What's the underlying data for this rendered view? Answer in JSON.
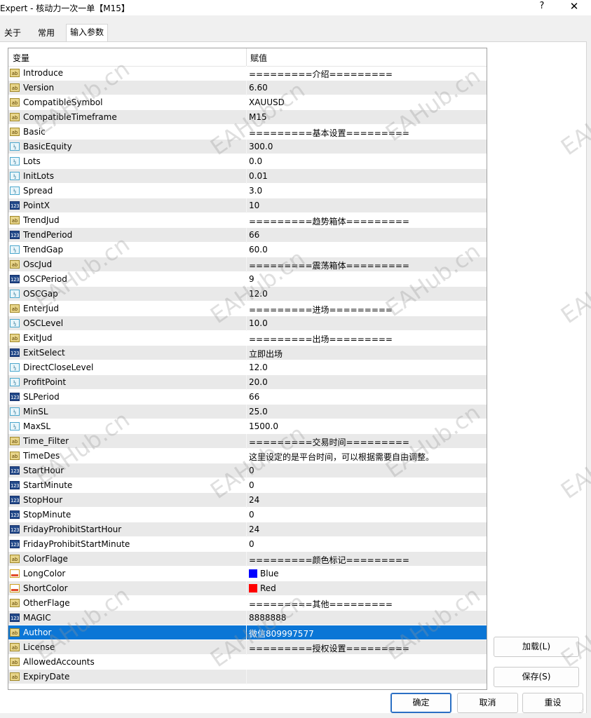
{
  "window": {
    "title": "Expert - 核动力一次一单【M15】",
    "help_label": "?",
    "close_label": "✕"
  },
  "tabs": [
    {
      "label": "关于"
    },
    {
      "label": "常用"
    },
    {
      "label": "输入参数"
    }
  ],
  "table": {
    "col_variable": "变量",
    "col_value": "赋值",
    "rows": [
      {
        "name": "Introduce",
        "value": "=========介绍=========",
        "type": "ab"
      },
      {
        "name": "Version",
        "value": "6.60",
        "type": "ab"
      },
      {
        "name": "CompatibleSymbol",
        "value": "XAUUSD",
        "type": "ab"
      },
      {
        "name": "CompatibleTimeframe",
        "value": "M15",
        "type": "ab"
      },
      {
        "name": "Basic",
        "value": "=========基本设置=========",
        "type": "ab"
      },
      {
        "name": "BasicEquity",
        "value": "300.0",
        "type": "half"
      },
      {
        "name": "Lots",
        "value": "0.0",
        "type": "half"
      },
      {
        "name": "InitLots",
        "value": "0.01",
        "type": "half"
      },
      {
        "name": "Spread",
        "value": "3.0",
        "type": "half"
      },
      {
        "name": "PointX",
        "value": "10",
        "type": "int"
      },
      {
        "name": "TrendJud",
        "value": "=========趋势箱体=========",
        "type": "ab"
      },
      {
        "name": "TrendPeriod",
        "value": "66",
        "type": "int"
      },
      {
        "name": "TrendGap",
        "value": "60.0",
        "type": "half"
      },
      {
        "name": "OscJud",
        "value": "=========震荡箱体=========",
        "type": "ab"
      },
      {
        "name": "OSCPeriod",
        "value": "9",
        "type": "int"
      },
      {
        "name": "OSCGap",
        "value": "12.0",
        "type": "half"
      },
      {
        "name": "EnterJud",
        "value": "=========进场=========",
        "type": "ab"
      },
      {
        "name": "OSCLevel",
        "value": "10.0",
        "type": "half"
      },
      {
        "name": "ExitJud",
        "value": "=========出场=========",
        "type": "ab"
      },
      {
        "name": "ExitSelect",
        "value": "立即出场",
        "type": "int"
      },
      {
        "name": "DirectCloseLevel",
        "value": "12.0",
        "type": "half"
      },
      {
        "name": "ProfitPoint",
        "value": "20.0",
        "type": "half"
      },
      {
        "name": "SLPeriod",
        "value": "66",
        "type": "int"
      },
      {
        "name": "MinSL",
        "value": "25.0",
        "type": "half"
      },
      {
        "name": "MaxSL",
        "value": "1500.0",
        "type": "half"
      },
      {
        "name": "Time_Filter",
        "value": "=========交易时间=========",
        "type": "ab"
      },
      {
        "name": "TimeDes",
        "value": "这里设定的是平台时间，可以根据需要自由调整。",
        "type": "ab"
      },
      {
        "name": "StartHour",
        "value": "0",
        "type": "int"
      },
      {
        "name": "StartMinute",
        "value": "0",
        "type": "int"
      },
      {
        "name": "StopHour",
        "value": "24",
        "type": "int"
      },
      {
        "name": "StopMinute",
        "value": "0",
        "type": "int"
      },
      {
        "name": "FridayProhibitStartHour",
        "value": "24",
        "type": "int"
      },
      {
        "name": "FridayProhibitStartMinute",
        "value": "0",
        "type": "int"
      },
      {
        "name": "ColorFlage",
        "value": "=========颜色标记=========",
        "type": "ab"
      },
      {
        "name": "LongColor",
        "value": "Blue",
        "type": "col",
        "swatch": "#0000ff"
      },
      {
        "name": "ShortColor",
        "value": "Red",
        "type": "col",
        "swatch": "#ff0000"
      },
      {
        "name": "OtherFlage",
        "value": "=========其他=========",
        "type": "ab"
      },
      {
        "name": "MAGIC",
        "value": "8888888",
        "type": "int"
      },
      {
        "name": "Author",
        "value": "微信809997577",
        "type": "ab",
        "selected": true
      },
      {
        "name": "License",
        "value": "=========授权设置=========",
        "type": "ab"
      },
      {
        "name": "AllowedAccounts",
        "value": "",
        "type": "ab"
      },
      {
        "name": "ExpiryDate",
        "value": "",
        "type": "ab"
      }
    ]
  },
  "icons": {
    "ab": {
      "glyph": "ab",
      "name": "string-type-icon"
    },
    "half": {
      "glyph": "½",
      "name": "double-type-icon"
    },
    "int": {
      "glyph": "123",
      "name": "integer-type-icon"
    },
    "col": {
      "glyph": "",
      "name": "color-type-icon"
    }
  },
  "buttons": {
    "load": "加载(L)",
    "save": "保存(S)",
    "ok": "确定",
    "cancel": "取消",
    "reset": "重设"
  },
  "watermark": "EAHub.cn",
  "colors": {
    "selection": "#0b76d6",
    "row_alt": "#e9e9e9"
  }
}
